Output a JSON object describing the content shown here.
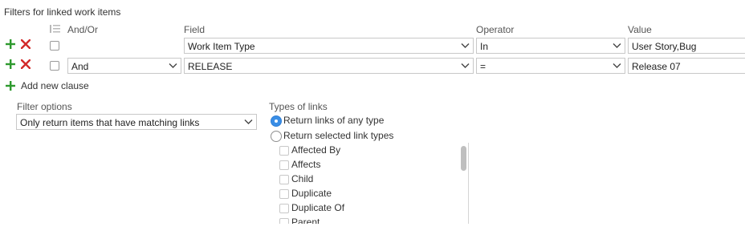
{
  "section_title": "Filters for linked work items",
  "columns": {
    "and_or": "And/Or",
    "field": "Field",
    "operator": "Operator",
    "value": "Value"
  },
  "clauses": [
    {
      "and_or": "",
      "field": "Work Item Type",
      "operator": "In",
      "value": "User Story,Bug"
    },
    {
      "and_or": "And",
      "field": "RELEASE",
      "operator": "=",
      "value": "Release 07"
    }
  ],
  "add_clause_label": "Add new clause",
  "filter_options": {
    "label": "Filter options",
    "selected": "Only return items that have matching links"
  },
  "link_types": {
    "label": "Types of links",
    "option_any": "Return links of any type",
    "option_selected": "Return selected link types",
    "selected_option": "any",
    "items": [
      "Affected By",
      "Affects",
      "Child",
      "Duplicate",
      "Duplicate Of",
      "Parent"
    ]
  },
  "colors": {
    "add_green": "#2e9a2e",
    "delete_red": "#d22b2b",
    "radio_blue": "#3a8ee6"
  },
  "icons": {
    "add": "plus-icon",
    "delete": "x-icon",
    "dropdown": "chevron-down-icon",
    "group": "group-clauses-icon"
  }
}
